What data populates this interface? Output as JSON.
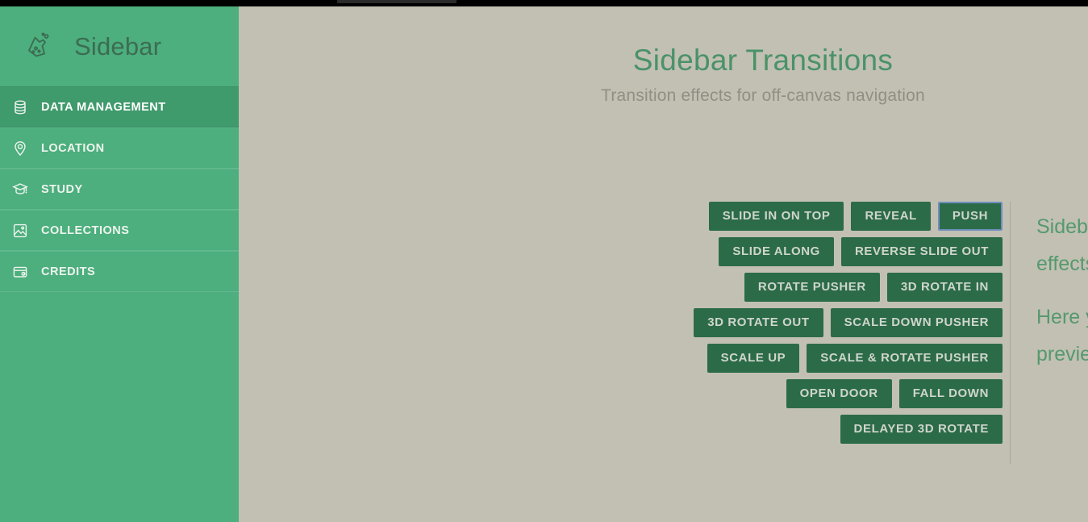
{
  "window": {
    "chrome_bar_color": "#000000",
    "background_color": "#c2c0b2"
  },
  "sidebar": {
    "brand": {
      "icon": "flask-icon",
      "label": "Sidebar"
    },
    "background_color": "#4caf7d",
    "active_item_color": "#3f9a6c",
    "items": [
      {
        "label": "Data Management",
        "icon": "database-icon",
        "active": true
      },
      {
        "label": "Location",
        "icon": "location-pin-icon",
        "active": false
      },
      {
        "label": "Study",
        "icon": "graduation-cap-icon",
        "active": false
      },
      {
        "label": "Collections",
        "icon": "image-gallery-icon",
        "active": false
      },
      {
        "label": "Credits",
        "icon": "wallet-icon",
        "active": false
      }
    ]
  },
  "main": {
    "title": "Sidebar Transitions",
    "subtitle": "Transition effects for off-canvas navigation",
    "title_color": "#4a9268",
    "subtitle_color": "#908f85",
    "button_color": "#2c6b48",
    "focus_outline_color": "#6f8fbf",
    "effect_rows": [
      [
        "Slide in on top",
        "Reveal",
        "Push"
      ],
      [
        "Slide along",
        "Reverse slide out"
      ],
      [
        "Rotate pusher",
        "3D rotate in"
      ],
      [
        "3D rotate out",
        "Scale down pusher"
      ],
      [
        "Scale up",
        "Scale & rotate pusher"
      ],
      [
        "Open door",
        "Fall down"
      ],
      [
        "Delayed 3D rotate"
      ]
    ],
    "focused_button": "Push",
    "description": {
      "paragraph_1": "Sidebar is a collection of off-canvas navigation effects that can be used to create modern menus.",
      "paragraph_2": "Here you can click any of the buttons shown to preview the corresponding transition effect."
    }
  }
}
